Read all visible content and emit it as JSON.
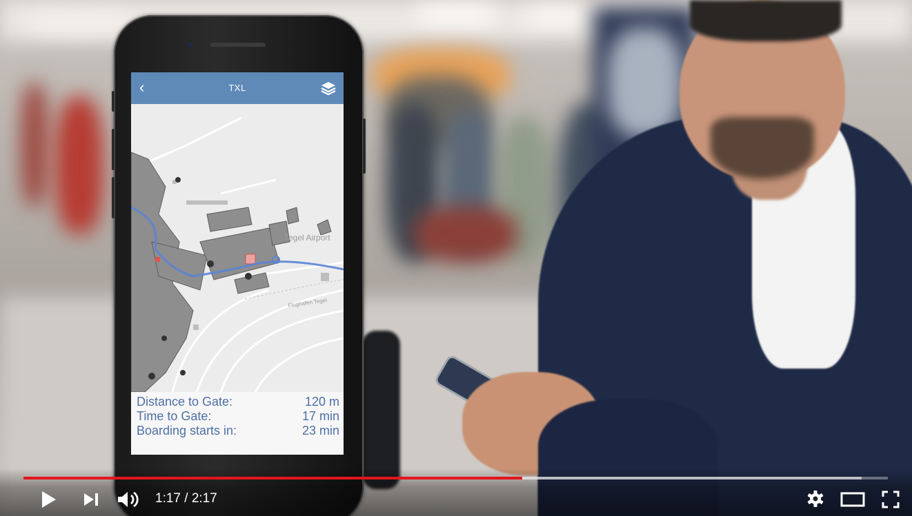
{
  "app": {
    "title": "TXL",
    "back_icon": "chevron-left-icon",
    "layers_icon": "layers-icon",
    "bar_color": "#5f8ab8"
  },
  "map": {
    "labels": [
      "Tegel Airport",
      "Flughafen Tegel"
    ],
    "route_color": "#5a84d6"
  },
  "stats": [
    {
      "label": "Distance to Gate:",
      "value": "120 m"
    },
    {
      "label": "Time to Gate:",
      "value": "17 min"
    },
    {
      "label": "Boarding starts in:",
      "value": "23 min"
    }
  ],
  "player": {
    "time_text": "1:17 / 2:17",
    "played_fraction": 0.577,
    "buffered_fraction": 0.97,
    "progress_color": "#e3161b",
    "icons": [
      "play-icon",
      "skip-next-icon",
      "volume-icon",
      "gear-icon",
      "theater-mode-icon",
      "fullscreen-icon"
    ]
  }
}
